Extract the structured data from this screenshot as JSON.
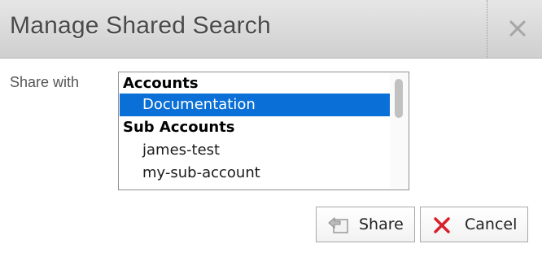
{
  "dialog": {
    "title": "Manage Shared Search",
    "close_icon": "close-icon"
  },
  "form": {
    "share_label": "Share with",
    "groups": [
      {
        "label": "Accounts",
        "items": [
          {
            "label": "Documentation",
            "selected": true
          }
        ]
      },
      {
        "label": "Sub Accounts",
        "items": [
          {
            "label": "james-test",
            "selected": false
          },
          {
            "label": "my-sub-account",
            "selected": false
          }
        ]
      }
    ],
    "selection_color": "#0a6fd6"
  },
  "buttons": {
    "share": {
      "label": "Share",
      "icon": "share-arrow-icon"
    },
    "cancel": {
      "label": "Cancel",
      "icon": "x-icon",
      "icon_color": "#d9202a"
    }
  }
}
